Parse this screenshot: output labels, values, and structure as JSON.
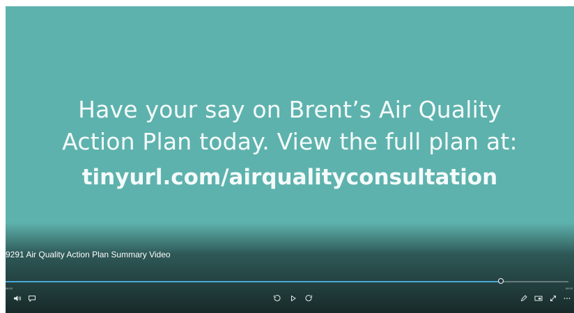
{
  "slide": {
    "line1": "Have your say on Brent’s Air Quality",
    "line2": "Action Plan today. View the full plan at:",
    "url": "tinyurl.com/airqualityconsultation"
  },
  "player": {
    "video_title": "9291 Air Quality Action Plan Summary Video",
    "time_elapsed": "04:10",
    "time_total": "04:10",
    "progress": 0.88,
    "accent_color": "#4aa8d8",
    "background_color": "#5eb2ad"
  },
  "controls": {
    "left": [
      "volume-icon",
      "captions-icon"
    ],
    "center": [
      "rewind-icon",
      "play-icon",
      "fast-forward-icon"
    ],
    "right": [
      "edit-icon",
      "theater-mode-icon",
      "fullscreen-icon",
      "more-icon"
    ]
  }
}
